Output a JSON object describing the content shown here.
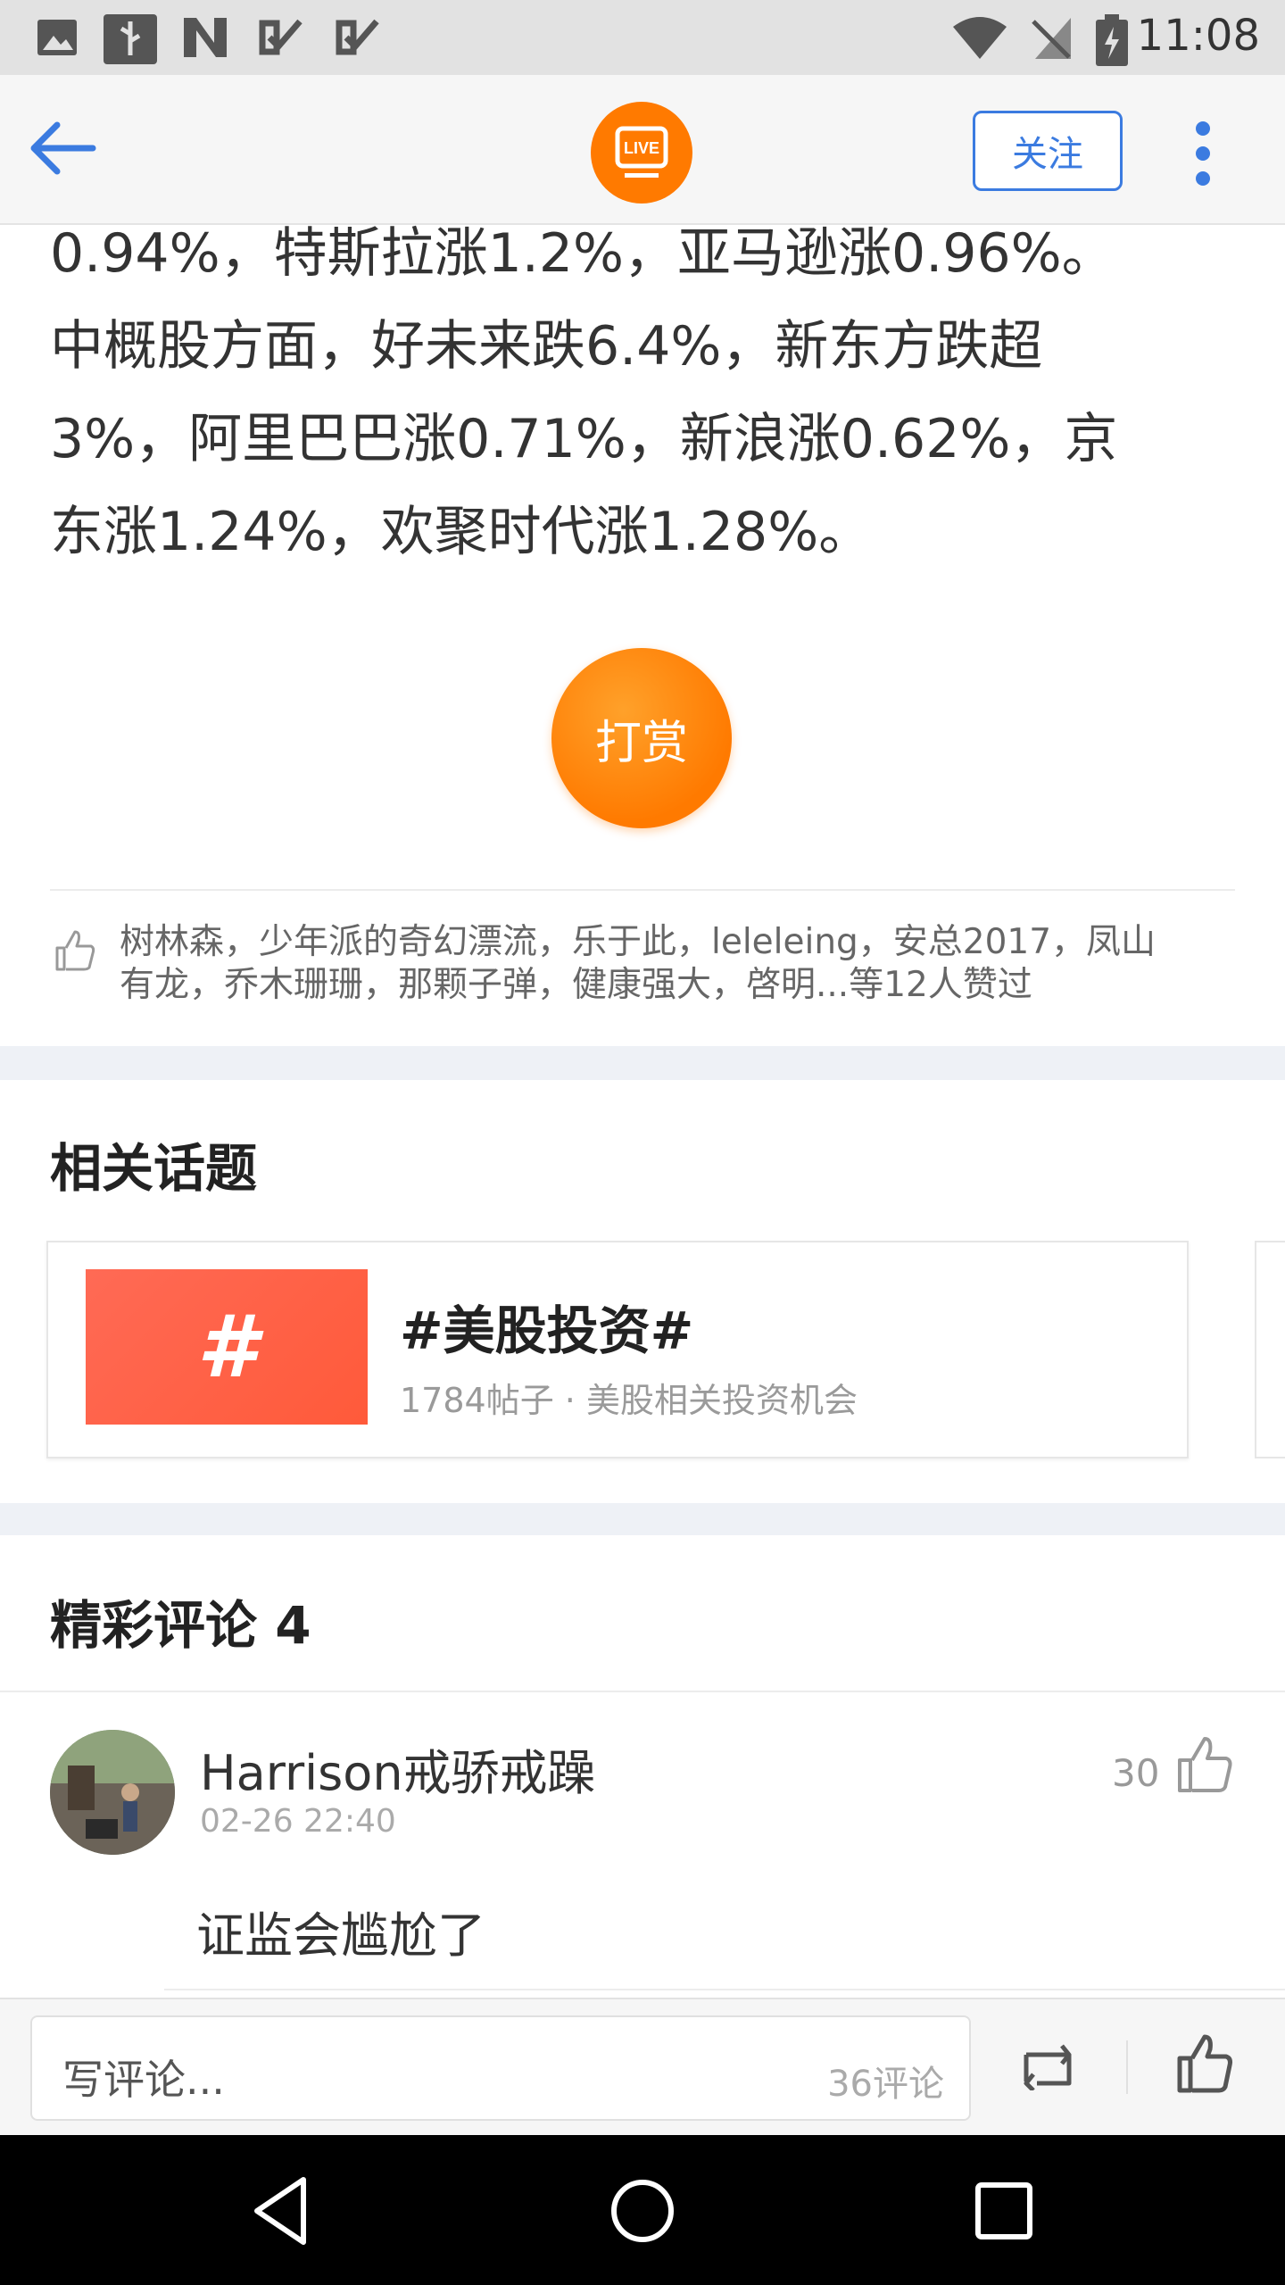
{
  "status_bar": {
    "time": "11:08",
    "icons": [
      "image-icon",
      "usb-icon",
      "n-icon",
      "check-icon",
      "check-icon",
      "wifi-icon",
      "no-sim-icon",
      "battery-charging-icon"
    ]
  },
  "header": {
    "back_icon": "arrow-left-icon",
    "live_badge": "LIVE",
    "follow_label": "关注",
    "more_icon": "more-vertical-icon"
  },
  "article": {
    "lines": [
      "0.94%，特斯拉涨1.2%，亚马逊涨0.96%。",
      "中概股方面，好未来跌6.4%，新东方跌超",
      "3%，阿里巴巴涨0.71%，新浪涨0.62%，京",
      "东涨1.24%，欢聚时代涨1.28%。"
    ]
  },
  "reward": {
    "label": "打赏"
  },
  "likes": {
    "line1": "树林森，少年派的奇幻漂流，乐于此，leleleing，安总2017，凤山",
    "line2": "有龙，乔木珊珊，那颗子弹，健康强大，啓明...等12人赞过"
  },
  "related": {
    "title": "相关话题",
    "topic": {
      "thumb_symbol": "#",
      "name": "#美股投资#",
      "meta": "1784帖子 · 美股相关投资机会"
    }
  },
  "comments": {
    "title": "精彩评论 4",
    "items": [
      {
        "user": "Harrison戒骄戒躁",
        "time": "02-26 22:40",
        "likes": "30",
        "text": "证监会尴尬了"
      }
    ]
  },
  "bottom_bar": {
    "placeholder": "写评论...",
    "count": "36评论"
  },
  "colors": {
    "accent_blue": "#3b7be0",
    "orange": "#ff7a00",
    "topic_red": "#ff5a3a"
  }
}
